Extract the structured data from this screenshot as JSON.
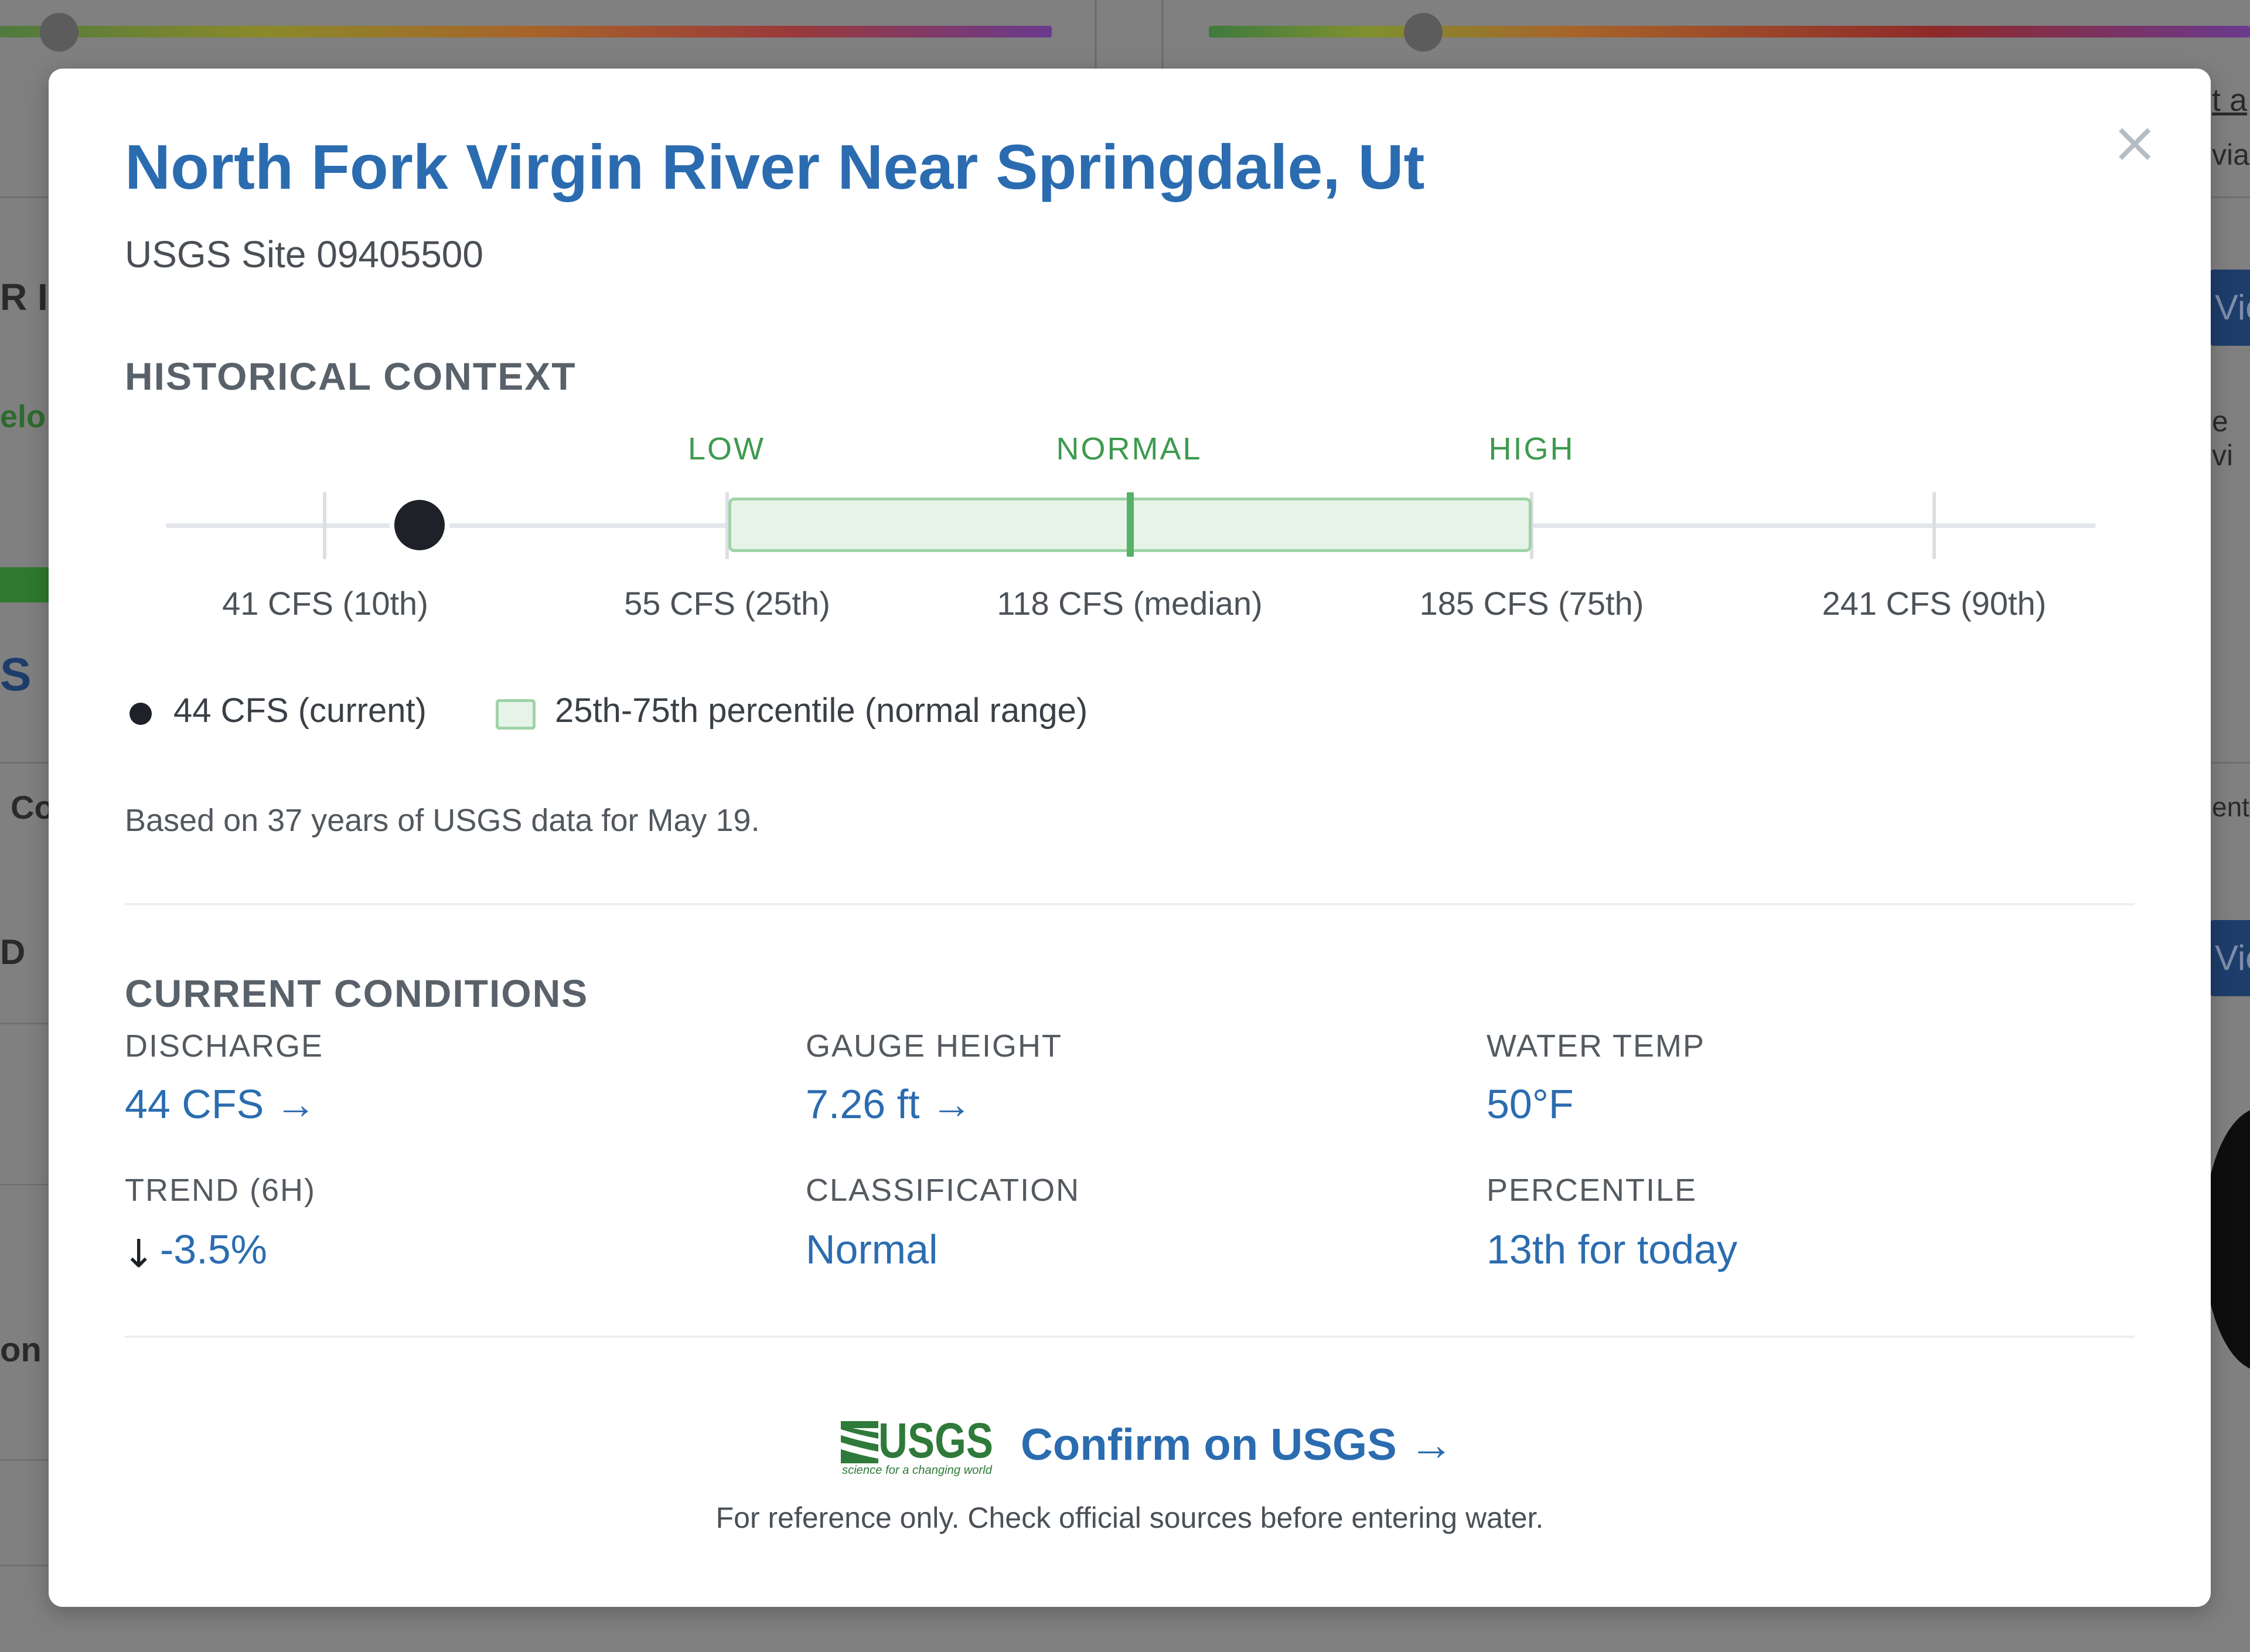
{
  "background": {
    "fragments": [
      "R I",
      "elo",
      "S",
      "Co",
      "D",
      "on",
      "t a",
      "via",
      "Vie",
      "e vi",
      "ent",
      "Vie"
    ]
  },
  "modal": {
    "title": "North Fork Virgin River Near Springdale, Ut",
    "subtitle": "USGS Site 09405500",
    "close_symbol": "×",
    "historical": {
      "section_title": "HISTORICAL CONTEXT",
      "range_labels": {
        "low": "LOW",
        "normal": "NORMAL",
        "high": "HIGH"
      },
      "ticks": [
        {
          "label": "41 CFS (10th)",
          "cfs": 41,
          "percentile": 10
        },
        {
          "label": "55 CFS (25th)",
          "cfs": 55,
          "percentile": 25
        },
        {
          "label": "118 CFS (median)",
          "cfs": 118,
          "percentile": 50
        },
        {
          "label": "185 CFS (75th)",
          "cfs": 185,
          "percentile": 75
        },
        {
          "label": "241 CFS (90th)",
          "cfs": 241,
          "percentile": 90
        }
      ],
      "current_cfs": 44,
      "legend_current": "44 CFS (current)",
      "legend_normal": "25th-75th percentile (normal range)",
      "note": "Based on 37 years of USGS data for May 19.",
      "colors": {
        "normal_band": "#e6f4e8",
        "normal_border": "#9fd3a7",
        "median": "#55b266",
        "dot": "#1e2228"
      }
    },
    "conditions": {
      "section_title": "CURRENT CONDITIONS",
      "discharge": {
        "label": "DISCHARGE",
        "value": "44 CFS →"
      },
      "gauge_height": {
        "label": "GAUGE HEIGHT",
        "value": "7.26 ft →"
      },
      "water_temp": {
        "label": "WATER TEMP",
        "value": "50°F"
      },
      "trend": {
        "label": "TREND (6H)",
        "arrow": "↓",
        "value": "-3.5%"
      },
      "classification": {
        "label": "CLASSIFICATION",
        "value": "Normal"
      },
      "percentile": {
        "label": "PERCENTILE",
        "value": "13th for today"
      }
    },
    "footer": {
      "logo_text": "USGS",
      "logo_tagline": "science for a changing world",
      "confirm_link": "Confirm on USGS →",
      "disclaimer": "For reference only. Check official sources before entering water."
    },
    "accent_color": "#2b6cb0"
  }
}
